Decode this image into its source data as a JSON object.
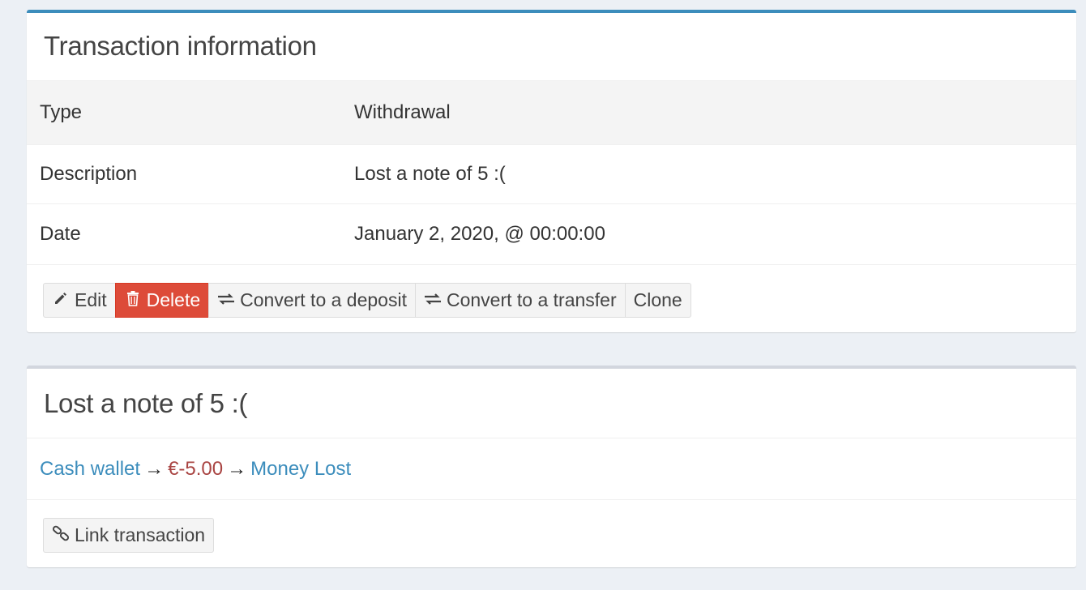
{
  "info_box": {
    "title": "Transaction information",
    "rows": [
      {
        "key": "Type",
        "value": "Withdrawal"
      },
      {
        "key": "Description",
        "value": "Lost a note of 5 :("
      },
      {
        "key": "Date",
        "value": "January 2, 2020, @ 00:00:00"
      }
    ],
    "buttons": {
      "edit": "Edit",
      "delete": "Delete",
      "convert_deposit": "Convert to a deposit",
      "convert_transfer": "Convert to a transfer",
      "clone": "Clone"
    },
    "icons": {
      "edit": "pencil-icon",
      "delete": "trash-icon",
      "convert_deposit": "exchange-icon",
      "convert_transfer": "exchange-icon"
    }
  },
  "split_box": {
    "title": "Lost a note of 5 :(",
    "source_account": "Cash wallet",
    "arrow": "→",
    "amount": "€-5.00",
    "destination_account": "Money Lost",
    "link_button": "Link transaction",
    "link_icon": "chain-link-icon"
  },
  "colors": {
    "primary": "#3c8dbc",
    "danger": "#dd4b39",
    "amount": "#a94442",
    "background": "#ecf0f5"
  }
}
